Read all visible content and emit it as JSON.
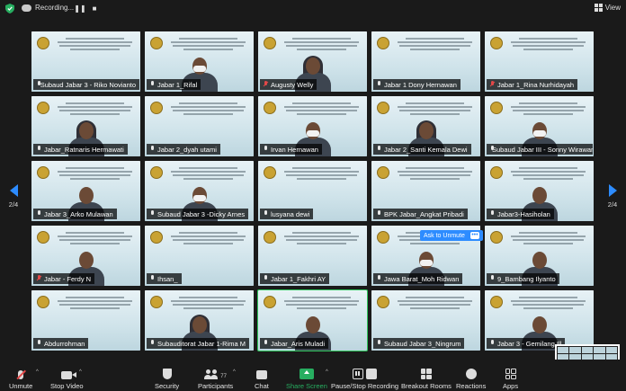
{
  "topbar": {
    "recording_label": "Recording...",
    "view_label": "View"
  },
  "participants_tiles": [
    {
      "name": "Subaud Jabar 3 - Riko Novianto",
      "mic": "on",
      "person": "none"
    },
    {
      "name": "Jabar 1_Rifal",
      "mic": "on",
      "person": "mask"
    },
    {
      "name": "Augusty Welly",
      "mic": "muted",
      "person": "hijab"
    },
    {
      "name": "Jabar 1 Dony Hernawan",
      "mic": "on",
      "person": "none"
    },
    {
      "name": "Jabar 1_Rina Nurhidayah",
      "mic": "muted",
      "person": "none"
    },
    {
      "name": "Jabar_Ratnaris Hermawati",
      "mic": "on",
      "person": "hijab"
    },
    {
      "name": "Jabar 2_dyah utami",
      "mic": "on",
      "person": "none"
    },
    {
      "name": "Irvan Hernawan",
      "mic": "on",
      "person": "mask"
    },
    {
      "name": "Jabar 2_Santi Kemala Dewi",
      "mic": "on",
      "person": "hijab"
    },
    {
      "name": "Subaud Jabar III - Sonny Wirawan",
      "mic": "on",
      "person": "mask"
    },
    {
      "name": "Jabar 3_Arko Mulawan",
      "mic": "on",
      "person": "plain"
    },
    {
      "name": "Subaud Jabar 3 -Dicky Arnes",
      "mic": "on",
      "person": "mask"
    },
    {
      "name": "lusyana dewi",
      "mic": "on",
      "person": "none"
    },
    {
      "name": "BPK Jabar_Angkat Pribadi",
      "mic": "on",
      "person": "none"
    },
    {
      "name": "Jabar3-Hasiholan",
      "mic": "on",
      "person": "plain"
    },
    {
      "name": "Jabar - Ferdy N",
      "mic": "muted",
      "person": "plain"
    },
    {
      "name": "Ihsan_",
      "mic": "on",
      "person": "none"
    },
    {
      "name": "Jabar 1_Fakhri AY",
      "mic": "on",
      "person": "none"
    },
    {
      "name": "Jawa Barat_Moh Ridwan",
      "mic": "on",
      "person": "mask"
    },
    {
      "name": "9_Bambang Ilyanto",
      "mic": "on",
      "person": "plain"
    },
    {
      "name": "Abdurrohman",
      "mic": "on",
      "person": "none"
    },
    {
      "name": "Subauditorat Jabar 1-Rima M",
      "mic": "on",
      "person": "hijab"
    },
    {
      "name": "Jabar_Aris Muladi",
      "mic": "on",
      "person": "plain"
    },
    {
      "name": "Subaud Jabar 3_Ningrum",
      "mic": "on",
      "person": "none"
    },
    {
      "name": "Jabar 3 - Gemilang Ill",
      "mic": "on",
      "person": "plain"
    }
  ],
  "popup": {
    "label": "Ask to Unmute",
    "more": "•••"
  },
  "pagination": {
    "left": "2/4",
    "right": "2/4"
  },
  "toolbar": {
    "unmute": "Unmute",
    "stop_video": "Stop Video",
    "security": "Security",
    "participants": "Participants",
    "participants_count": "77",
    "chat": "Chat",
    "share_screen": "Share Screen",
    "pause_stop_recording": "Pause/Stop Recording",
    "breakout_rooms": "Breakout Rooms",
    "reactions": "Reactions",
    "apps": "Apps"
  },
  "colors": {
    "accent": "#2d8cff",
    "share": "#27ae60",
    "muted": "#e34848",
    "active_speaker": "#2ec45b"
  }
}
